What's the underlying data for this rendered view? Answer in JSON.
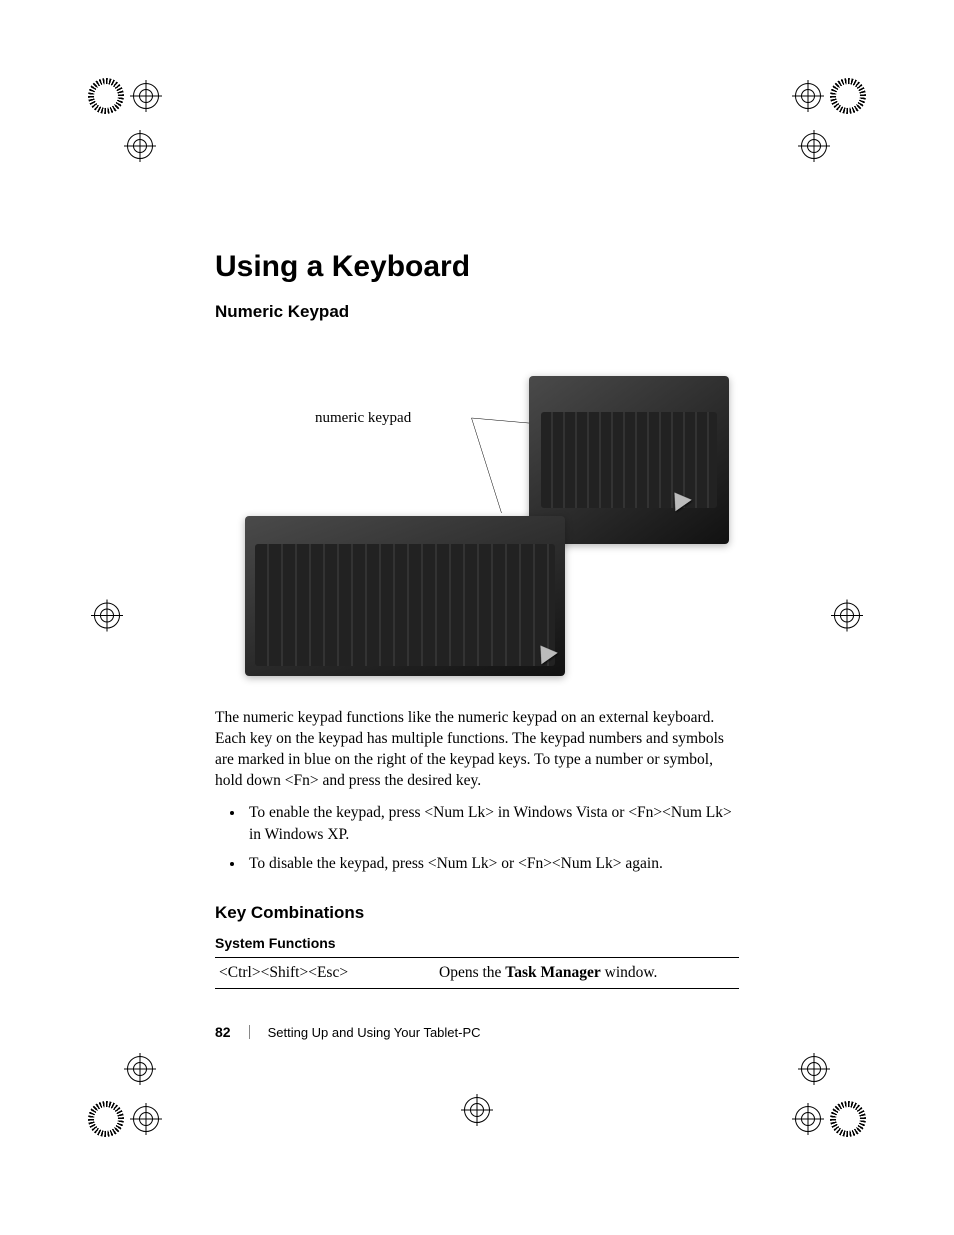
{
  "header": {
    "title": "Using a Keyboard"
  },
  "section_numeric": {
    "heading": "Numeric Keypad",
    "figure_caption": "numeric keypad",
    "para": "The numeric keypad functions like the numeric keypad on an external keyboard. Each key on the keypad has multiple functions. The keypad numbers and symbols are marked in blue on the right of the keypad keys. To type a number or symbol, hold down <Fn> and press the desired key.",
    "bullets": [
      "To enable the keypad, press <Num Lk> in Windows Vista or <Fn><Num Lk> in Windows XP.",
      "To disable the keypad, press <Num Lk> or <Fn><Num Lk> again."
    ]
  },
  "section_keycomb": {
    "heading": "Key Combinations",
    "subheading": "System Functions",
    "rows": [
      {
        "keys": "<Ctrl><Shift><Esc>",
        "desc_prefix": "Opens the ",
        "desc_bold": "Task Manager",
        "desc_suffix": " window."
      }
    ]
  },
  "footer": {
    "page_number": "82",
    "chapter": "Setting Up and Using Your Tablet-PC"
  }
}
